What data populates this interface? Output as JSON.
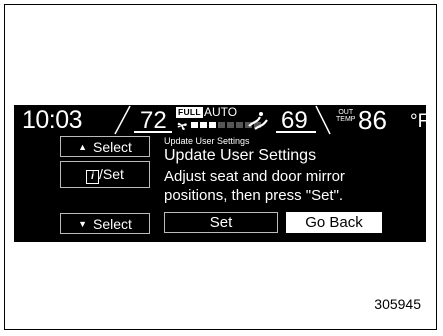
{
  "status_bar": {
    "time": "10:03",
    "driver_temp": "72",
    "fan_mode_badge": "FULL",
    "auto_label": "AUTO",
    "fan_level": 3,
    "fan_level_max": 8,
    "passenger_temp": "69",
    "outside_temp_badge_line1": "OUT",
    "outside_temp_badge_line2": "TEMP",
    "outside_temp": "86",
    "outside_temp_unit": "°F",
    "icons": [
      "fan-icon",
      "air-vent-icon"
    ]
  },
  "side_buttons": {
    "select_up": "Select",
    "info_set": "/Set",
    "select_down": "Select"
  },
  "dialog": {
    "header_small": "Update User Settings",
    "title": "Update User Settings",
    "message_line1": "Adjust seat and door mirror",
    "message_line2": "positions, then press \"Set\".",
    "set_button": "Set",
    "go_back_button": "Go Back"
  },
  "figure_code": "305945",
  "colors": {
    "screen_bg": "#000000",
    "screen_text": "#ffffff",
    "page_bg": "#ffffff"
  }
}
